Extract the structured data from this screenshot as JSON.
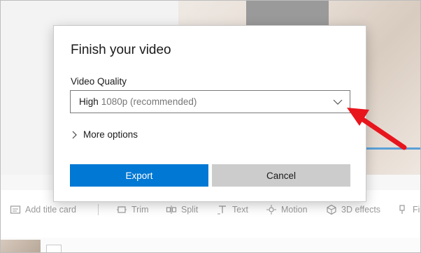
{
  "dialog": {
    "title": "Finish your video",
    "quality_label": "Video Quality",
    "quality_value_main": "High",
    "quality_value_detail": "1080p (recommended)",
    "more_options_label": "More options",
    "export_label": "Export",
    "cancel_label": "Cancel",
    "accent_color": "#0078d4"
  },
  "toolbar": {
    "items": [
      {
        "label": "Add title card",
        "icon": "title-card-icon"
      },
      {
        "label": "Trim",
        "icon": "trim-icon"
      },
      {
        "label": "Split",
        "icon": "split-icon"
      },
      {
        "label": "Text",
        "icon": "text-icon"
      },
      {
        "label": "Motion",
        "icon": "motion-icon"
      },
      {
        "label": "3D effects",
        "icon": "3d-effects-icon"
      },
      {
        "label": "Fi",
        "icon": "filters-icon"
      }
    ]
  },
  "annotation": {
    "color": "#e8151d",
    "icon": "red-arrow-icon"
  }
}
